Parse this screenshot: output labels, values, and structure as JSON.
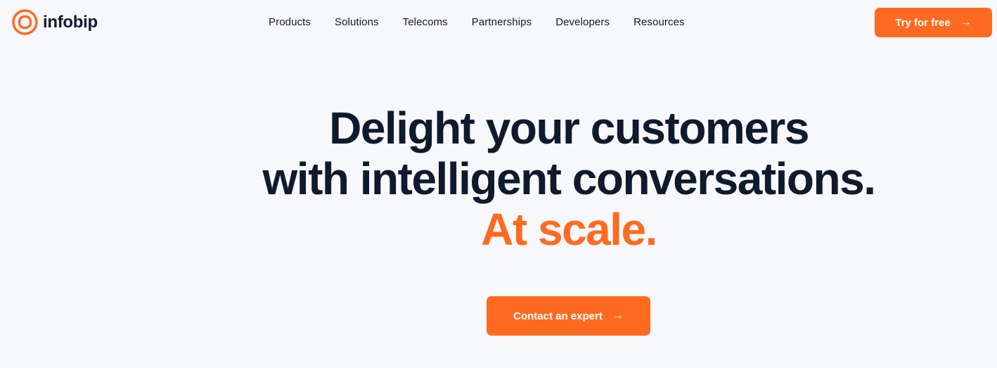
{
  "brand": {
    "name": "infobip",
    "accent_color": "#ff6a21",
    "text_color": "#0f1b2d",
    "background_color": "#f7f8fc"
  },
  "nav": {
    "items": [
      {
        "label": "Products"
      },
      {
        "label": "Solutions"
      },
      {
        "label": "Telecoms"
      },
      {
        "label": "Partnerships"
      },
      {
        "label": "Developers"
      },
      {
        "label": "Resources"
      }
    ],
    "cta_label": "Try for free",
    "cta_icon": "arrow-right-icon"
  },
  "hero": {
    "line1": "Delight your customers",
    "line2": "with intelligent conversations.",
    "line3": "At scale.",
    "cta_label": "Contact an expert",
    "cta_icon": "arrow-right-icon"
  }
}
